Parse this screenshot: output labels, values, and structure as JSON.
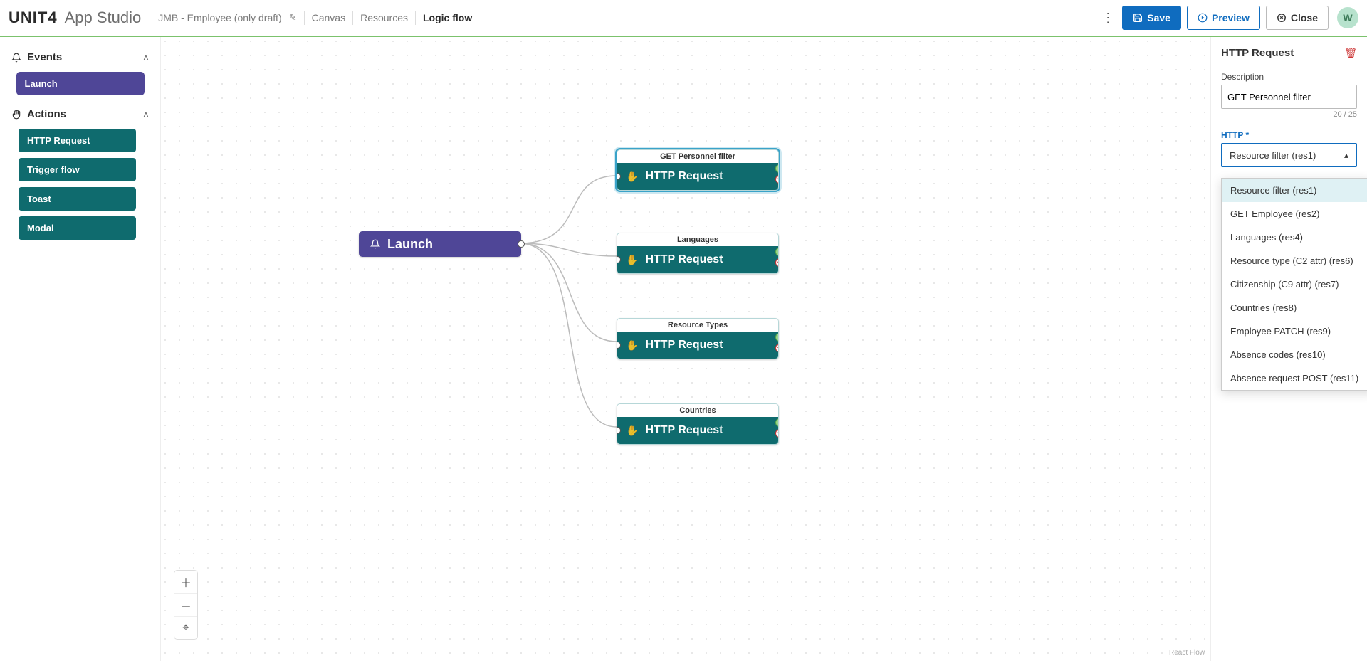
{
  "header": {
    "brand": "UNIT4",
    "app_name": "App Studio",
    "project_name": "JMB - Employee (only draft)",
    "tabs": {
      "canvas": "Canvas",
      "resources": "Resources",
      "logic_flow": "Logic flow"
    },
    "save": "Save",
    "preview": "Preview",
    "close": "Close",
    "avatar_initial": "W"
  },
  "sidebar": {
    "events_title": "Events",
    "actions_title": "Actions",
    "event_items": [
      "Launch"
    ],
    "action_items": [
      "HTTP Request",
      "Trigger flow",
      "Toast",
      "Modal"
    ]
  },
  "canvas": {
    "launch_label": "Launch",
    "http_label": "HTTP Request",
    "react_flow_attr": "React Flow",
    "nodes": [
      {
        "desc": "GET Personnel filter"
      },
      {
        "desc": "Languages"
      },
      {
        "desc": "Resource Types"
      },
      {
        "desc": "Countries"
      }
    ]
  },
  "right_panel": {
    "title": "HTTP Request",
    "description_label": "Description",
    "description_value": "GET Personnel filter",
    "char_count": "20 / 25",
    "http_label": "HTTP",
    "selected_option": "Resource filter (res1)",
    "options": [
      "Resource filter (res1)",
      "GET Employee (res2)",
      "Languages (res4)",
      "Resource type (C2 attr) (res6)",
      "Citizenship (C9 attr) (res7)",
      "Countries (res8)",
      "Employee PATCH (res9)",
      "Absence codes (res10)",
      "Absence request POST (res11)"
    ]
  }
}
